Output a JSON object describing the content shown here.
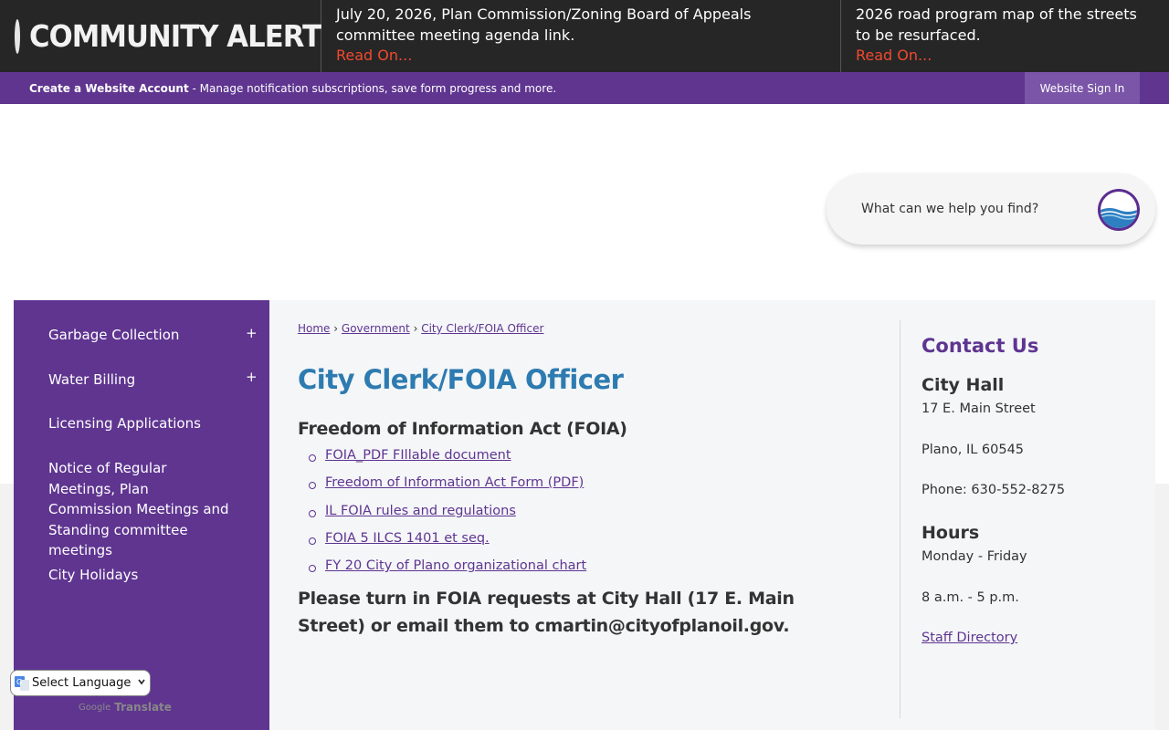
{
  "alert": {
    "title": "COMMUNITY ALERT",
    "items": [
      {
        "text": "July 20, 2026, Plan Commission/Zoning Board of Appeals committee meeting agenda link.",
        "link": "Read On..."
      },
      {
        "text": "2026 road program map of the streets to be resurfaced.",
        "link": "Read On..."
      }
    ]
  },
  "account": {
    "create_label": "Create a Website Account",
    "description": " - Manage notification subscriptions, save form progress and more.",
    "signin_label": "Website Sign In"
  },
  "search": {
    "placeholder": "What can we help you find?",
    "icon": "search-icon"
  },
  "sidebar": {
    "items": [
      {
        "label": "Garbage Collection",
        "expand": "+"
      },
      {
        "label": "Water Billing",
        "expand": "+"
      },
      {
        "label": "Licensing Applications"
      },
      {
        "label": "Notice of Regular Meetings, Plan Commission Meetings and Standing committee meetings"
      },
      {
        "label": "City Holidays"
      }
    ]
  },
  "breadcrumb": {
    "home": "Home",
    "sep": "›",
    "government": "Government",
    "current": "City Clerk/FOIA Officer"
  },
  "main": {
    "title": "City Clerk/FOIA Officer",
    "section_heading": "Freedom of Information Act (FOIA)",
    "links": [
      "FOIA_PDF FIllable document",
      "Freedom of Information Act Form (PDF)",
      "IL FOIA rules and regulations",
      "FOIA 5 ILCS 1401 et seq.",
      "FY 20 City of Plano organizational chart"
    ],
    "note": "Please turn in FOIA requests at City Hall (17 E. Main Street) or email them to cmartin@cityofplanoil.gov."
  },
  "contact": {
    "title": "Contact Us",
    "office": "City Hall",
    "address1": "17 E. Main Street",
    "address2": "Plano, IL 60545",
    "phone": "Phone: 630-552-8275",
    "hours_heading": "Hours",
    "days": "Monday - Friday",
    "time": "8 a.m. - 5 p.m.",
    "directory_link": "Staff Directory"
  },
  "translate": {
    "select_label": "Select Language",
    "powered_by": "Google",
    "translate_word": "Translate"
  },
  "colors": {
    "purple": "#5f3590",
    "title_blue": "#2d7bb0",
    "alert_red": "#f04a2f",
    "alert_bg": "#262626"
  }
}
